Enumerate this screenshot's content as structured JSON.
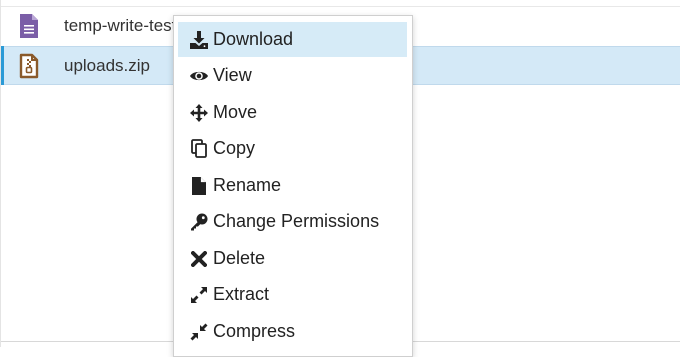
{
  "files": [
    {
      "name": "temp-write-test",
      "icon": "document-icon",
      "icon_color": "#7b5ea7"
    },
    {
      "name": "uploads.zip",
      "icon": "zip-file-icon",
      "icon_color": "#8a5a2b",
      "selected": true
    }
  ],
  "context_menu": {
    "items": [
      {
        "label": "Download",
        "icon": "download-icon"
      },
      {
        "label": "View",
        "icon": "eye-icon"
      },
      {
        "label": "Move",
        "icon": "move-arrows-icon"
      },
      {
        "label": "Copy",
        "icon": "copy-icon"
      },
      {
        "label": "Rename",
        "icon": "file-icon"
      },
      {
        "label": "Change Permissions",
        "icon": "key-icon"
      },
      {
        "label": "Delete",
        "icon": "x-icon"
      },
      {
        "label": "Extract",
        "icon": "expand-icon"
      },
      {
        "label": "Compress",
        "icon": "compress-icon"
      }
    ]
  },
  "colors": {
    "selected_row": "#d4e9f7",
    "selected_accent": "#2b9ad6",
    "menu_hover": "#d6ebf7"
  }
}
